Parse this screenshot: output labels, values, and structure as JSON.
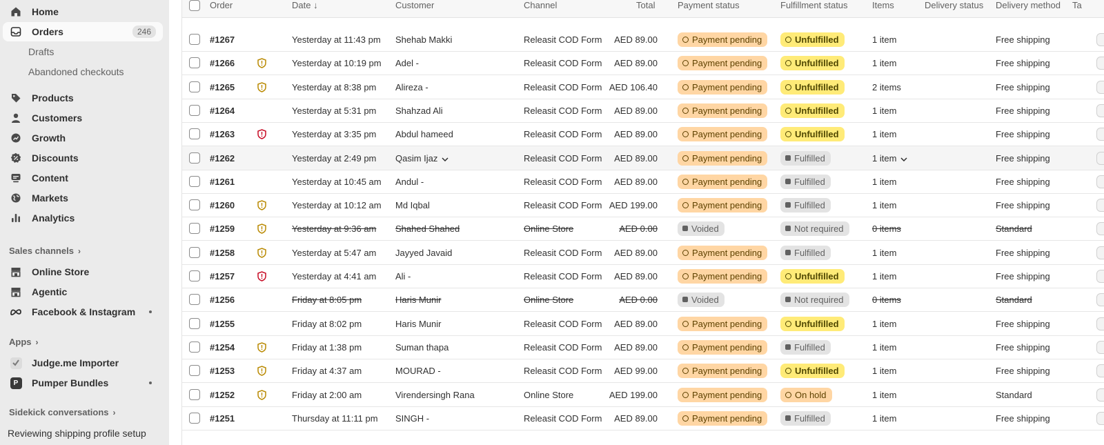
{
  "sidebar": {
    "home": "Home",
    "orders": "Orders",
    "orders_count": "246",
    "drafts": "Drafts",
    "abandoned": "Abandoned checkouts",
    "products": "Products",
    "customers": "Customers",
    "growth": "Growth",
    "discounts": "Discounts",
    "content": "Content",
    "markets": "Markets",
    "analytics": "Analytics",
    "sales_channels": "Sales channels",
    "online_store": "Online Store",
    "agentic": "Agentic",
    "facebook": "Facebook & Instagram",
    "apps": "Apps",
    "judgeme": "Judge.me Importer",
    "pumper": "Pumper Bundles",
    "sidekick": "Sidekick conversations",
    "reviewing": "Reviewing shipping profile setup"
  },
  "columns": {
    "order": "Order",
    "date": "Date",
    "sort_arrow": "↓",
    "customer": "Customer",
    "channel": "Channel",
    "total": "Total",
    "payment": "Payment status",
    "fulfillment": "Fulfillment status",
    "items": "Items",
    "delivery_status": "Delivery status",
    "delivery_method": "Delivery method",
    "tags": "Ta"
  },
  "orders": [
    {
      "id": "#1267",
      "risk": "",
      "date": "Yesterday at 11:43 pm",
      "customer": "Shehab Makki",
      "channel": "Releasit COD Form",
      "total": "AED 89.00",
      "payment": "Payment pending",
      "pay_type": "pending",
      "fulfillment": "Unfulfilled",
      "ful_type": "unfulfilled",
      "items": "1 item",
      "delivery": "Free shipping",
      "strike": false
    },
    {
      "id": "#1266",
      "risk": "medium",
      "date": "Yesterday at 10:19 pm",
      "customer": "Adel -",
      "channel": "Releasit COD Form",
      "total": "AED 89.00",
      "payment": "Payment pending",
      "pay_type": "pending",
      "fulfillment": "Unfulfilled",
      "ful_type": "unfulfilled",
      "items": "1 item",
      "delivery": "Free shipping",
      "strike": false
    },
    {
      "id": "#1265",
      "risk": "medium",
      "date": "Yesterday at 8:38 pm",
      "customer": "Alireza -",
      "channel": "Releasit COD Form",
      "total": "AED 106.40",
      "payment": "Payment pending",
      "pay_type": "pending",
      "fulfillment": "Unfulfilled",
      "ful_type": "unfulfilled",
      "items": "2 items",
      "delivery": "Free shipping",
      "strike": false
    },
    {
      "id": "#1264",
      "risk": "",
      "date": "Yesterday at 5:31 pm",
      "customer": "Shahzad Ali",
      "channel": "Releasit COD Form",
      "total": "AED 89.00",
      "payment": "Payment pending",
      "pay_type": "pending",
      "fulfillment": "Unfulfilled",
      "ful_type": "unfulfilled",
      "items": "1 item",
      "delivery": "Free shipping",
      "strike": false
    },
    {
      "id": "#1263",
      "risk": "high",
      "date": "Yesterday at 3:35 pm",
      "customer": "Abdul hameed",
      "channel": "Releasit COD Form",
      "total": "AED 89.00",
      "payment": "Payment pending",
      "pay_type": "pending",
      "fulfillment": "Unfulfilled",
      "ful_type": "unfulfilled",
      "items": "1 item",
      "delivery": "Free shipping",
      "strike": false
    },
    {
      "id": "#1262",
      "risk": "",
      "date": "Yesterday at 2:49 pm",
      "customer": "Qasim Ijaz",
      "channel": "Releasit COD Form",
      "total": "AED 89.00",
      "payment": "Payment pending",
      "pay_type": "pending",
      "fulfillment": "Fulfilled",
      "ful_type": "fulfilled",
      "items": "1 item",
      "delivery": "Free shipping",
      "strike": false,
      "hover": true
    },
    {
      "id": "#1261",
      "risk": "",
      "date": "Yesterday at 10:45 am",
      "customer": "Andul -",
      "channel": "Releasit COD Form",
      "total": "AED 89.00",
      "payment": "Payment pending",
      "pay_type": "pending",
      "fulfillment": "Fulfilled",
      "ful_type": "fulfilled",
      "items": "1 item",
      "delivery": "Free shipping",
      "strike": false
    },
    {
      "id": "#1260",
      "risk": "medium",
      "date": "Yesterday at 10:12 am",
      "customer": "Md Iqbal",
      "channel": "Releasit COD Form",
      "total": "AED 199.00",
      "payment": "Payment pending",
      "pay_type": "pending",
      "fulfillment": "Fulfilled",
      "ful_type": "fulfilled",
      "items": "1 item",
      "delivery": "Free shipping",
      "strike": false
    },
    {
      "id": "#1259",
      "risk": "medium",
      "date": "Yesterday at 9:36 am",
      "customer": "Shahed Shahed",
      "channel": "Online Store",
      "total": "AED 0.00",
      "payment": "Voided",
      "pay_type": "voided",
      "fulfillment": "Not required",
      "ful_type": "notreq",
      "items": "0 items",
      "delivery": "Standard",
      "strike": true
    },
    {
      "id": "#1258",
      "risk": "medium",
      "date": "Yesterday at 5:47 am",
      "customer": "Jayyed Javaid",
      "channel": "Releasit COD Form",
      "total": "AED 89.00",
      "payment": "Payment pending",
      "pay_type": "pending",
      "fulfillment": "Fulfilled",
      "ful_type": "fulfilled",
      "items": "1 item",
      "delivery": "Free shipping",
      "strike": false
    },
    {
      "id": "#1257",
      "risk": "high",
      "date": "Yesterday at 4:41 am",
      "customer": "Ali -",
      "channel": "Releasit COD Form",
      "total": "AED 89.00",
      "payment": "Payment pending",
      "pay_type": "pending",
      "fulfillment": "Unfulfilled",
      "ful_type": "unfulfilled",
      "items": "1 item",
      "delivery": "Free shipping",
      "strike": false
    },
    {
      "id": "#1256",
      "risk": "",
      "date": "Friday at 8:05 pm",
      "customer": "Haris Munir",
      "channel": "Online Store",
      "total": "AED 0.00",
      "payment": "Voided",
      "pay_type": "voided",
      "fulfillment": "Not required",
      "ful_type": "notreq",
      "items": "0 items",
      "delivery": "Standard",
      "strike": true
    },
    {
      "id": "#1255",
      "risk": "",
      "date": "Friday at 8:02 pm",
      "customer": "Haris Munir",
      "channel": "Releasit COD Form",
      "total": "AED 89.00",
      "payment": "Payment pending",
      "pay_type": "pending",
      "fulfillment": "Unfulfilled",
      "ful_type": "unfulfilled",
      "items": "1 item",
      "delivery": "Free shipping",
      "strike": false
    },
    {
      "id": "#1254",
      "risk": "medium",
      "date": "Friday at 1:38 pm",
      "customer": "Suman thapa",
      "channel": "Releasit COD Form",
      "total": "AED 89.00",
      "payment": "Payment pending",
      "pay_type": "pending",
      "fulfillment": "Fulfilled",
      "ful_type": "fulfilled",
      "items": "1 item",
      "delivery": "Free shipping",
      "strike": false
    },
    {
      "id": "#1253",
      "risk": "medium",
      "date": "Friday at 4:37 am",
      "customer": "MOURAD -",
      "channel": "Releasit COD Form",
      "total": "AED 99.00",
      "payment": "Payment pending",
      "pay_type": "pending",
      "fulfillment": "Unfulfilled",
      "ful_type": "unfulfilled",
      "items": "1 item",
      "delivery": "Free shipping",
      "strike": false
    },
    {
      "id": "#1252",
      "risk": "medium",
      "date": "Friday at 2:00 am",
      "customer": "Virendersingh Rana",
      "channel": "Online Store",
      "total": "AED 199.00",
      "payment": "Payment pending",
      "pay_type": "pending",
      "fulfillment": "On hold",
      "ful_type": "onhold",
      "items": "1 item",
      "delivery": "Standard",
      "strike": false
    },
    {
      "id": "#1251",
      "risk": "",
      "date": "Thursday at 11:11 pm",
      "customer": "SINGH -",
      "channel": "Releasit COD Form",
      "total": "AED 89.00",
      "payment": "Payment pending",
      "pay_type": "pending",
      "fulfillment": "Fulfilled",
      "ful_type": "fulfilled",
      "items": "1 item",
      "delivery": "Free shipping",
      "strike": false
    }
  ],
  "colors": {
    "risk_medium": "#b98900",
    "risk_high": "#c70a24",
    "pending_bg": "#ffd6a4",
    "unfulfilled_bg": "#ffeb78",
    "neutral_bg": "#e3e3e3"
  }
}
